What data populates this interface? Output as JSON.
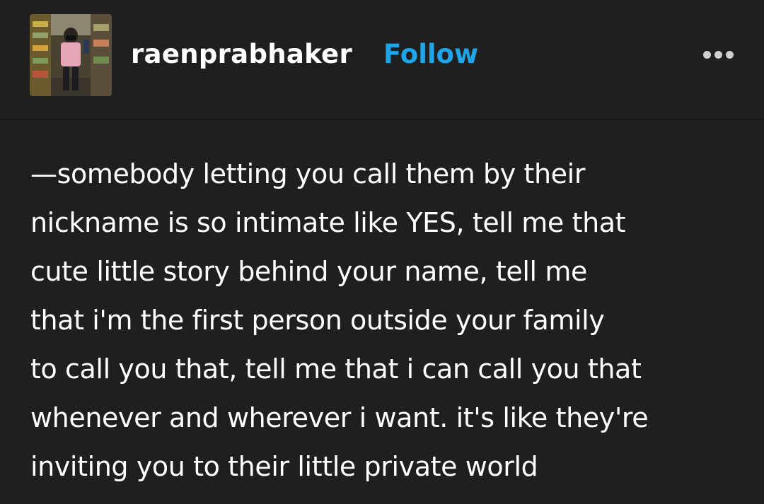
{
  "post": {
    "username": "raenprabhaker",
    "follow_label": "Follow",
    "more_icon": "ellipsis-icon",
    "body_lines": [
      "—somebody letting you call them by their",
      "nickname is so intimate like YES, tell me that",
      "cute little story behind your name, tell me",
      "that i'm the first person outside your family",
      "to call you that, tell me that i can call you that",
      "whenever and wherever i want. it's like they're",
      "inviting you to their little private world"
    ]
  },
  "colors": {
    "background": "#1f1f1f",
    "text": "#ffffff",
    "follow": "#1fa6e8",
    "divider": "#141414"
  }
}
